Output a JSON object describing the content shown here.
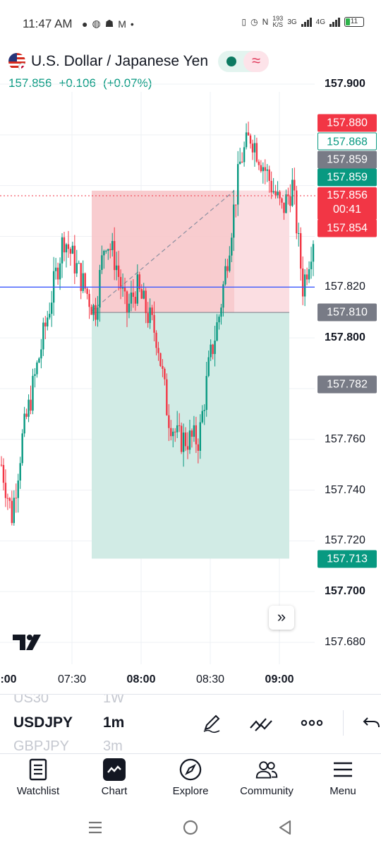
{
  "status_bar": {
    "time": "11:47 AM",
    "net_speed_value": "193",
    "net_speed_unit": "K/S",
    "net1": "3G",
    "net2": "4G",
    "battery": "11"
  },
  "header": {
    "symbol_name": "U.S. Dollar / Japanese Yen",
    "last_price": "157.856",
    "change": "+0.106",
    "change_pct": "(+0.07%)"
  },
  "axis": {
    "price_labels": [
      {
        "text": "157.900",
        "bold": true,
        "value": 157.9
      },
      {
        "text": "157.820",
        "bold": false,
        "value": 157.82
      },
      {
        "text": "157.800",
        "bold": true,
        "value": 157.8
      },
      {
        "text": "157.760",
        "bold": false,
        "value": 157.76
      },
      {
        "text": "157.740",
        "bold": false,
        "value": 157.74
      },
      {
        "text": "157.720",
        "bold": false,
        "value": 157.72
      },
      {
        "text": "157.700",
        "bold": true,
        "value": 157.7
      },
      {
        "text": "157.680",
        "bold": false,
        "value": 157.68
      }
    ],
    "price_boxes": [
      {
        "text": "157.880",
        "style": "red",
        "value": 157.88
      },
      {
        "text": "157.868",
        "style": "outline",
        "value": 157.868
      },
      {
        "text": "157.859",
        "style": "gray",
        "value": 157.859
      },
      {
        "text": "157.859",
        "style": "green",
        "value": 157.859
      },
      {
        "text": "157.856",
        "sub": "00:41",
        "style": "red",
        "value": 157.856
      },
      {
        "text": "157.854",
        "style": "red",
        "value": 157.854
      },
      {
        "text": "157.810",
        "style": "gray",
        "value": 157.81
      },
      {
        "text": "157.782",
        "style": "gray",
        "value": 157.782
      },
      {
        "text": "157.713",
        "style": "green",
        "value": 157.713
      }
    ],
    "time_labels": [
      {
        "text": ":00",
        "bold": true
      },
      {
        "text": "07:30",
        "bold": false
      },
      {
        "text": "08:00",
        "bold": true
      },
      {
        "text": "08:30",
        "bold": false
      },
      {
        "text": "09:00",
        "bold": true
      }
    ]
  },
  "chart_data": {
    "type": "candlestick",
    "symbol": "USDJPY",
    "interval": "1m",
    "ylim": [
      157.676,
      157.904
    ],
    "horizontal_line": 157.82,
    "current_price_line": 157.856,
    "position": {
      "entry": 157.81,
      "stop": 157.858,
      "target": 157.713
    },
    "price_path": [
      157.75,
      157.73,
      157.76,
      157.78,
      157.8,
      157.82,
      157.84,
      157.83,
      157.82,
      157.81,
      157.84,
      157.83,
      157.81,
      157.82,
      157.81,
      157.8,
      157.77,
      157.76,
      157.76,
      157.76,
      157.79,
      157.81,
      157.84,
      157.87,
      157.88,
      157.87,
      157.86,
      157.85,
      157.86,
      157.82,
      157.84
    ]
  },
  "picker": {
    "prev_symbol": "US30",
    "prev_interval": "1W",
    "symbol": "USDJPY",
    "interval": "1m",
    "next_symbol": "GBPJPY",
    "next_interval": "3m"
  },
  "nav": {
    "items": [
      {
        "label": "Watchlist"
      },
      {
        "label": "Chart"
      },
      {
        "label": "Explore"
      },
      {
        "label": "Community"
      },
      {
        "label": "Menu"
      }
    ]
  }
}
